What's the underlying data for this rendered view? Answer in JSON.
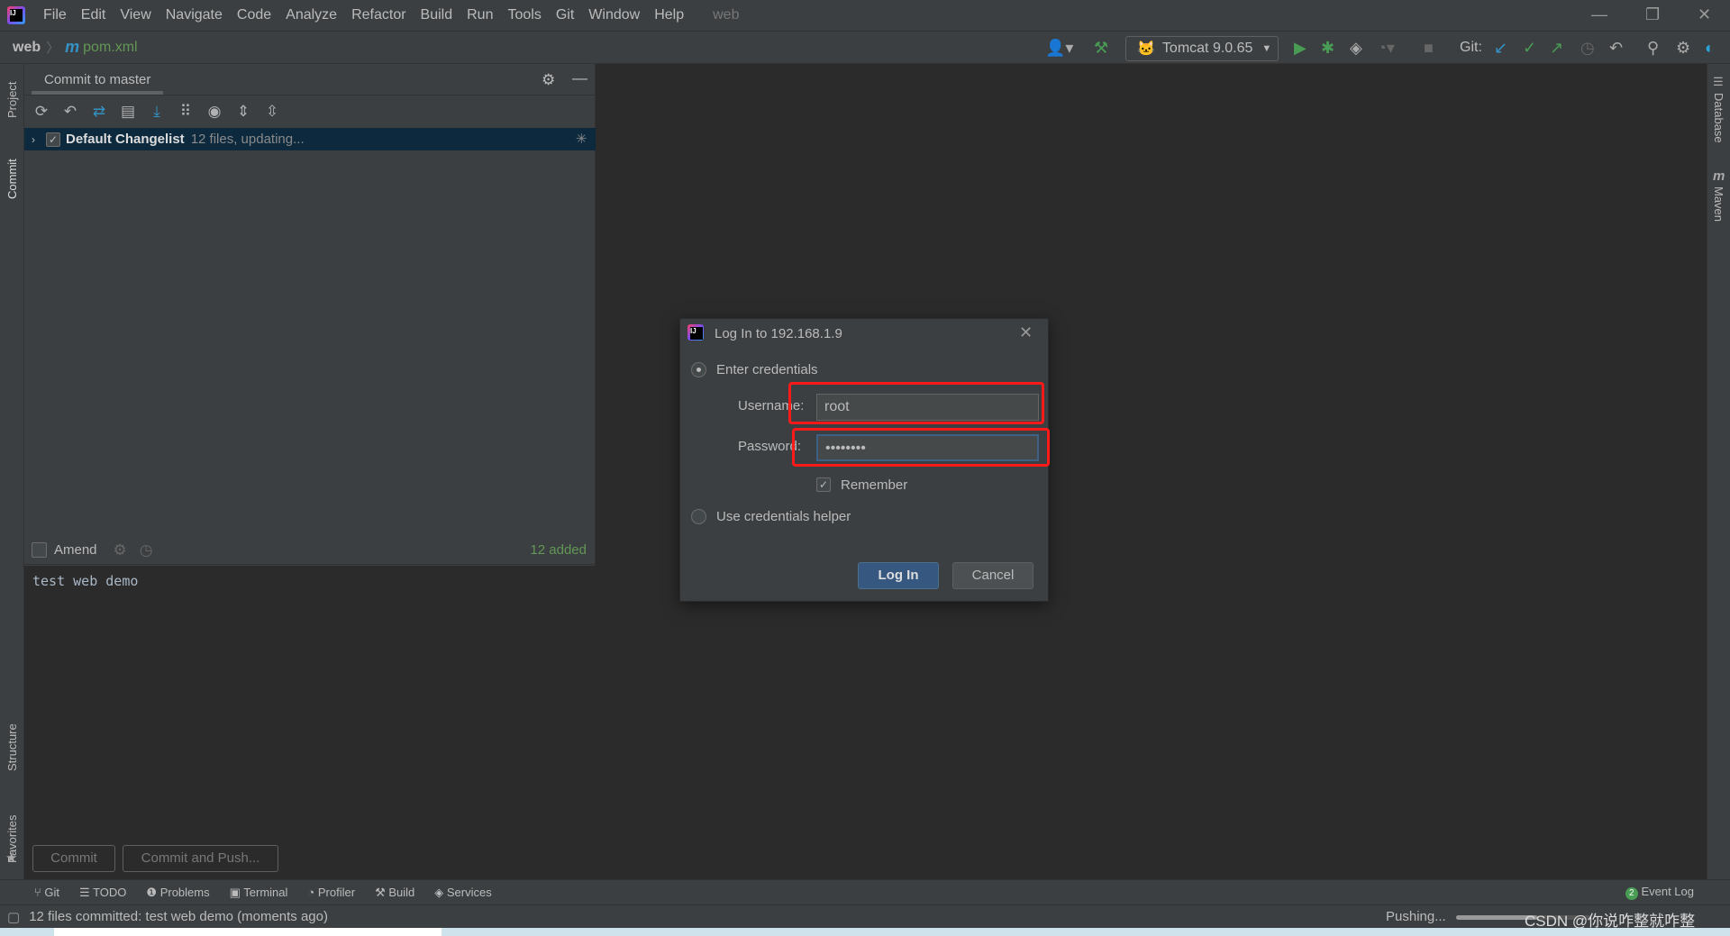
{
  "menu": {
    "items": [
      "File",
      "Edit",
      "View",
      "Navigate",
      "Code",
      "Analyze",
      "Refactor",
      "Build",
      "Run",
      "Tools",
      "Git",
      "Window",
      "Help"
    ],
    "project_title": "web"
  },
  "breadcrumb": {
    "project": "web",
    "file": "pom.xml"
  },
  "toolbar": {
    "run_config": "Tomcat 9.0.65",
    "git_label": "Git:"
  },
  "left_strip": {
    "project": "Project",
    "commit": "Commit",
    "structure": "Structure",
    "favorites": "Favorites"
  },
  "right_strip": {
    "database": "Database",
    "maven": "Maven"
  },
  "commit_panel": {
    "tab": "Commit to master",
    "changelist_name": "Default Changelist",
    "changelist_status": "12 files, updating...",
    "changelist_checked": true,
    "amend_label": "Amend",
    "amend_checked": false,
    "added_count": "12 added",
    "message": "test web demo",
    "commit_button": "Commit",
    "commit_push_button": "Commit and Push..."
  },
  "dialog": {
    "title": "Log In to 192.168.1.9",
    "option_enter": "Enter credentials",
    "username_label": "Username:",
    "username_value": "root",
    "password_label": "Password:",
    "password_value": "••••••••",
    "remember_label": "Remember",
    "remember_checked": true,
    "option_helper": "Use credentials helper",
    "login_button": "Log In",
    "cancel_button": "Cancel",
    "selected_option": "Enter credentials"
  },
  "tool_windows": [
    "Git",
    "TODO",
    "Problems",
    "Terminal",
    "Profiler",
    "Build",
    "Services"
  ],
  "event_log": {
    "label": "Event Log",
    "count": "2"
  },
  "status": {
    "message": "12 files committed: test web demo (moments ago)",
    "progress_label": "Pushing...",
    "watermark": "CSDN @你说咋整就咋整"
  },
  "colors": {
    "accent_blue": "#365880",
    "added_green": "#629755",
    "highlight_red": "#ff1a1a",
    "selection": "#0d293e"
  }
}
